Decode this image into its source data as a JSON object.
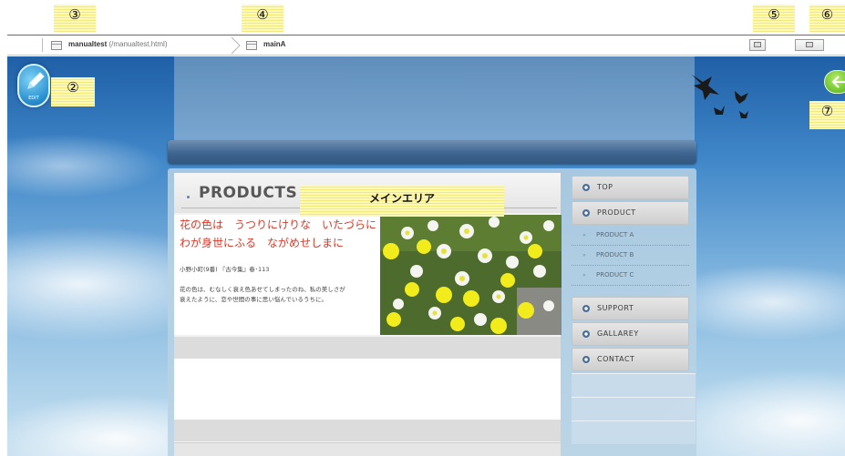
{
  "callouts": {
    "c2": "②",
    "c3": "③",
    "c4": "④",
    "c5": "⑤",
    "c6": "⑥",
    "c7": "⑦",
    "main_area": "メインエリア"
  },
  "toolbar": {
    "page_name": "manualtest",
    "page_path": "(/manualtest.html)",
    "crumb_name": "mainA"
  },
  "edit_button": {
    "label": "EDIT",
    "icon": "pencil-icon"
  },
  "back_button": {
    "icon": "back-arrow-icon"
  },
  "site": {
    "heading": "PRODUCTS",
    "poem_line_1": "花の色は　うつりにけりな　いたづらに",
    "poem_line_2": "わが身世にふる　ながめせしまに",
    "poem_source": "小野小町(9番) 『古今集』春･113",
    "desc_line_1": "花の色は、むなしく衰え色あせてしまったのね、私の美しさが",
    "desc_line_2": "衰えたように、恋や世間の事に思い悩んでいるうちに。",
    "nav": {
      "top": "TOP",
      "product": "PRODUCT",
      "product_a": "PRODUCT A",
      "product_b": "PRODUCT B",
      "product_c": "PRODUCT C",
      "support": "SUPPORT",
      "gallery": "GALLAREY",
      "contact": "CONTACT"
    }
  },
  "colors": {
    "callout": "#fff9b8",
    "navbar": "#3e6590",
    "poem_text": "#d83a2a",
    "back_button": "#6cc12a",
    "edit_button": "#2a8fd0"
  }
}
